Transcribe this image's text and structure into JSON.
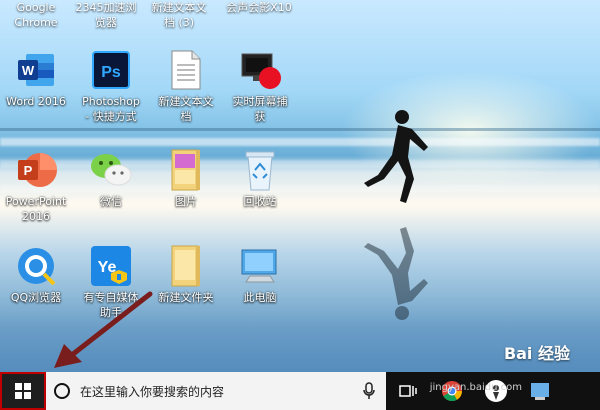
{
  "top_row_labels": [
    {
      "line1": "Google",
      "line2": "Chrome"
    },
    {
      "line1": "2345加速浏",
      "line2": "览器"
    },
    {
      "line1": "新建文本文",
      "line2": "档 (3)"
    },
    {
      "line1": "会声会影X10",
      "line2": ""
    }
  ],
  "icons": [
    {
      "line1": "Word 2016",
      "line2": "",
      "icon": "word-icon"
    },
    {
      "line1": "Photoshop",
      "line2": "- 快捷方式",
      "icon": "photoshop-icon"
    },
    {
      "line1": "新建文本文",
      "line2": "档",
      "icon": "text-file-icon"
    },
    {
      "line1": "实时屏幕捕",
      "line2": "获",
      "icon": "screen-capture-icon"
    },
    {
      "line1": "PowerPoint",
      "line2": "2016",
      "icon": "powerpoint-icon"
    },
    {
      "line1": "微信",
      "line2": "",
      "icon": "wechat-icon"
    },
    {
      "line1": "图片",
      "line2": "",
      "icon": "folder-pictures-icon"
    },
    {
      "line1": "回收站",
      "line2": "",
      "icon": "recycle-bin-icon"
    },
    {
      "line1": "QQ浏览器",
      "line2": "",
      "icon": "qq-browser-icon"
    },
    {
      "line1": "有专自媒体",
      "line2": "助手",
      "icon": "media-assistant-icon"
    },
    {
      "line1": "新建文件夹",
      "line2": "",
      "icon": "folder-icon"
    },
    {
      "line1": "此电脑",
      "line2": "",
      "icon": "this-pc-icon"
    }
  ],
  "taskbar": {
    "search_placeholder": "在这里输入你要搜索的内容"
  },
  "watermark": {
    "text": "Bai 经验",
    "url": "jingyan.baidu.com"
  },
  "colors": {
    "taskbar": "#101010",
    "start_highlight": "#c00000",
    "search_bg": "#f3f3f3"
  }
}
